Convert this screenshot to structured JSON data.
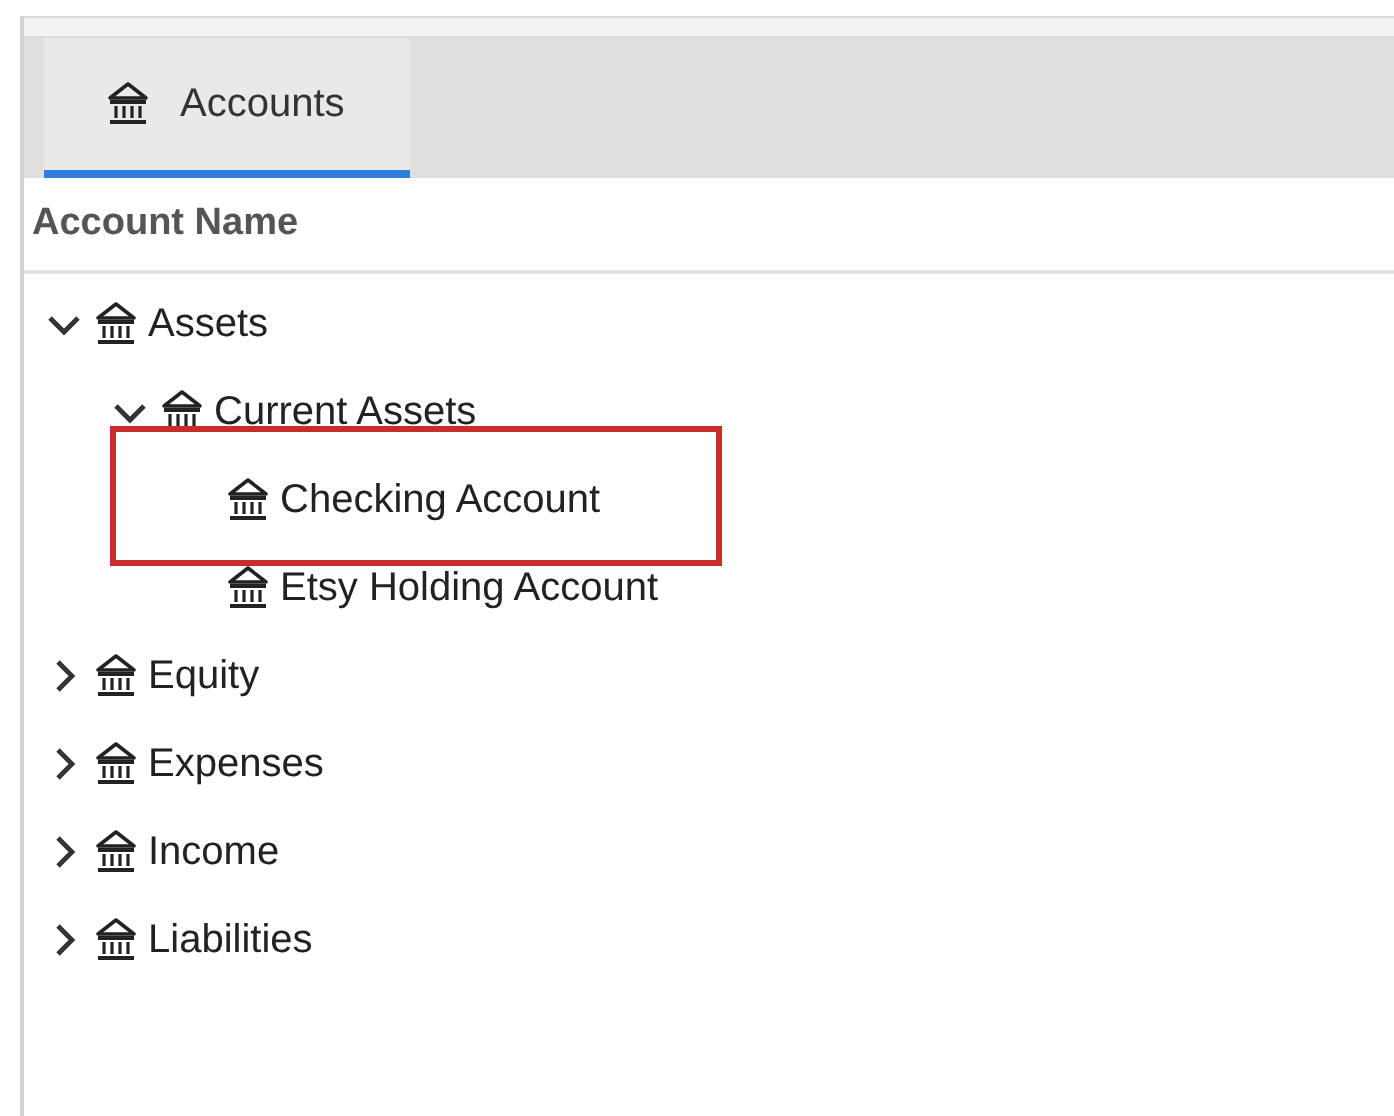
{
  "tabs": [
    {
      "label": "Accounts",
      "selected": true
    }
  ],
  "table": {
    "columns": [
      "Account Name"
    ]
  },
  "tree": [
    {
      "label": "Assets",
      "expanded": true,
      "highlighted": false,
      "children": [
        {
          "label": "Current Assets",
          "expanded": true,
          "highlighted": false,
          "children": [
            {
              "label": "Checking Account",
              "highlighted": true
            },
            {
              "label": "Etsy Holding Account",
              "highlighted": false
            }
          ]
        }
      ]
    },
    {
      "label": "Equity",
      "expanded": false,
      "highlighted": false
    },
    {
      "label": "Expenses",
      "expanded": false,
      "highlighted": false
    },
    {
      "label": "Income",
      "expanded": false,
      "highlighted": false
    },
    {
      "label": "Liabilities",
      "expanded": false,
      "highlighted": false
    }
  ]
}
